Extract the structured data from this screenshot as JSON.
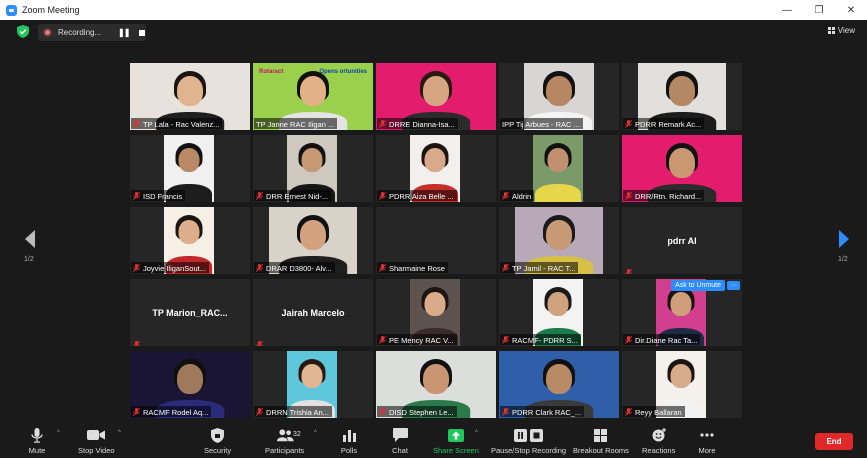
{
  "window": {
    "title": "Zoom Meeting",
    "min": "—",
    "max": "❐",
    "close": "✕"
  },
  "recording": {
    "label": "Recording..."
  },
  "view_label": "View",
  "page": {
    "left": "1/2",
    "right": "1/2"
  },
  "tiles": [
    {
      "label": "TP Lala - Rac Valenz...",
      "muted": true,
      "video": "full",
      "bg": "#e8e2dc",
      "skin": "#e0b48e",
      "hair": "#1c1410",
      "shirt": "#1f1f1f"
    },
    {
      "label": "TP Janne RAC Iligan ...",
      "muted": false,
      "active": true,
      "video": "full",
      "bg": "#9ad04c",
      "skin": "#e2b185",
      "hair": "#111111",
      "shirt": "#e4e4e4",
      "banner_a": "Rotaract",
      "banner_b": "Opens ortunities"
    },
    {
      "label": "DRRE Dianna-Isa...",
      "muted": true,
      "video": "full",
      "bg": "#e41c6e",
      "skin": "#d8a583",
      "hair": "#2a1a12",
      "shirt": "#2b2b2b"
    },
    {
      "label": "IPP Tij Arbues - RAC ...",
      "muted": false,
      "video": "tiny",
      "bg": "#d8d6d4",
      "skin": "#b78662",
      "hair": "#111111",
      "shirt": "#f4f4f4"
    },
    {
      "label": "PDRR Remark Ac...",
      "muted": true,
      "video": "wide",
      "bg": "#e2e0dd",
      "skin": "#b48864",
      "hair": "#111111",
      "shirt": "#1c1c1c"
    },
    {
      "label": "ISD Francis",
      "muted": true,
      "video": "mid",
      "bg": "#f0f0f0",
      "skin": "#b98864",
      "hair": "#111111",
      "shirt": "#1d1d1d"
    },
    {
      "label": "DRR Ernest Nid-...",
      "muted": true,
      "video": "mid",
      "bg": "#cfc8bf",
      "skin": "#c69873",
      "hair": "#111111",
      "shirt": "#161616"
    },
    {
      "label": "PDRR Aiza Belle ...",
      "muted": true,
      "video": "mid",
      "bg": "#f2f0ee",
      "skin": "#d8a98a",
      "hair": "#1f1510",
      "shirt": "#c7302a"
    },
    {
      "label": "Aldrin",
      "muted": true,
      "video": "mid",
      "bg": "#7a9a6a",
      "skin": "#c09070",
      "hair": "#111111",
      "shirt": "#e7d64a"
    },
    {
      "label": "DRR/Rtn. Richard...",
      "muted": true,
      "video": "full",
      "bg": "#e41c6e",
      "skin": "#c99772",
      "hair": "#111111",
      "shirt": "#2b2b2b"
    },
    {
      "label": "Joyvie IliganSout...",
      "muted": true,
      "video": "mid",
      "bg": "#f5efe6",
      "skin": "#dcae8c",
      "hair": "#1c1410",
      "shirt": "#c22a2a"
    },
    {
      "label": "DRAR D3800- Alv...",
      "muted": true,
      "video": "wide",
      "bg": "#d8d2c8",
      "skin": "#d2a27e",
      "hair": "#111111",
      "shirt": "#1e1e1e"
    },
    {
      "label": "Sharmaine Rose",
      "muted": true,
      "video": "none"
    },
    {
      "label": "TP Jamil - RAC T...",
      "muted": true,
      "video": "wide",
      "bg": "#b7a9b8",
      "skin": "#c79a75",
      "hair": "#1a1a1a",
      "shirt": "#d7c045"
    },
    {
      "label": "",
      "muted": true,
      "video": "name",
      "name": "pdrr Al"
    },
    {
      "label": "",
      "muted": true,
      "video": "name",
      "name": "TP  Marion_RAC..."
    },
    {
      "label": "",
      "muted": true,
      "video": "name",
      "name": "Jairah Marcelo"
    },
    {
      "label": "PE Mency RAC V...",
      "muted": true,
      "video": "mid",
      "bg": "#5c5350",
      "skin": "#d9ab8b",
      "hair": "#1e1410",
      "shirt": "#3a2c2a"
    },
    {
      "label": "RACMF- PDRR S...",
      "muted": true,
      "video": "mid",
      "bg": "#f3f3f3",
      "skin": "#d1a27e",
      "hair": "#1a1a1a",
      "shirt": "#1b7b4b"
    },
    {
      "label": "Dir.Diane Rac Ta...",
      "muted": true,
      "video": "mid",
      "bg": "#d23f8e",
      "skin": "#cf9f7c",
      "hair": "#1a1310",
      "shirt": "#1f2a44",
      "unmute": "Ask to Unmute",
      "more": "···"
    },
    {
      "label": "RACMF Rodel Aq...",
      "muted": true,
      "video": "full",
      "bg": "#1a1534",
      "skin": "#a0785c",
      "hair": "#101010",
      "shirt": "#2b2b7a"
    },
    {
      "label": "DRRN Trishia An...",
      "muted": true,
      "video": "mid",
      "bg": "#5fc7dc",
      "skin": "#e1b693",
      "hair": "#2a1a12",
      "shirt": "#e2e2e2"
    },
    {
      "label": "DISD Stephen Le...",
      "muted": true,
      "video": "full",
      "bg": "#dcdedc",
      "skin": "#c99572",
      "hair": "#111111",
      "shirt": "#2c7a4a"
    },
    {
      "label": "PDRR Clark RAC_...",
      "muted": true,
      "video": "full",
      "bg": "#2f5fa8",
      "skin": "#b88a66",
      "hair": "#111111",
      "shirt": "#3a3a3a"
    },
    {
      "label": "Reyy Ballaran",
      "muted": true,
      "video": "mid",
      "bg": "#f4f0ec",
      "skin": "#d8ab8c",
      "hair": "#1c1410",
      "shirt": "#f2f2f2"
    }
  ],
  "toolbar": {
    "mute": "Mute",
    "stop_video": "Stop Video",
    "security": "Security",
    "participants": "Participants",
    "participants_count": "32",
    "polls": "Polls",
    "chat": "Chat",
    "share_screen": "Share Screen",
    "record": "Pause/Stop Recording",
    "breakout": "Breakout Rooms",
    "reactions": "Reactions",
    "more": "More",
    "end": "End"
  },
  "colors": {
    "accent": "#2d8cff",
    "share": "#22c55e",
    "end": "#e02828",
    "active_speaker": "#cddc39",
    "muted_mic": "#e03131"
  }
}
